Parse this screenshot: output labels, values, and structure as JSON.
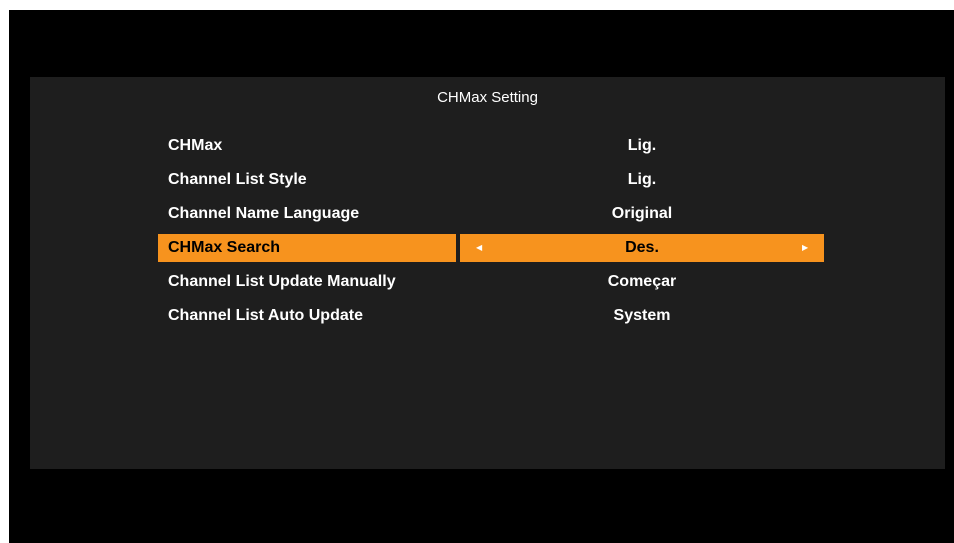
{
  "screen": {
    "title": "CHMax Setting"
  },
  "menu": {
    "items": [
      {
        "label": "CHMax",
        "value": "Lig."
      },
      {
        "label": "Channel List Style",
        "value": "Lig."
      },
      {
        "label": "Channel Name Language",
        "value": "Original"
      },
      {
        "label": "CHMax Search",
        "value": "Des."
      },
      {
        "label": "Channel List Update Manually",
        "value": "Começar"
      },
      {
        "label": "Channel List Auto Update",
        "value": "System"
      }
    ],
    "selected_index": 3,
    "left_arrow_icon": "arrow-left-icon",
    "right_arrow_icon": "arrow-right-icon"
  },
  "colors": {
    "highlight": "#f7931e",
    "panel": "#1e1e1e",
    "background": "#000000",
    "text": "#ffffff"
  }
}
